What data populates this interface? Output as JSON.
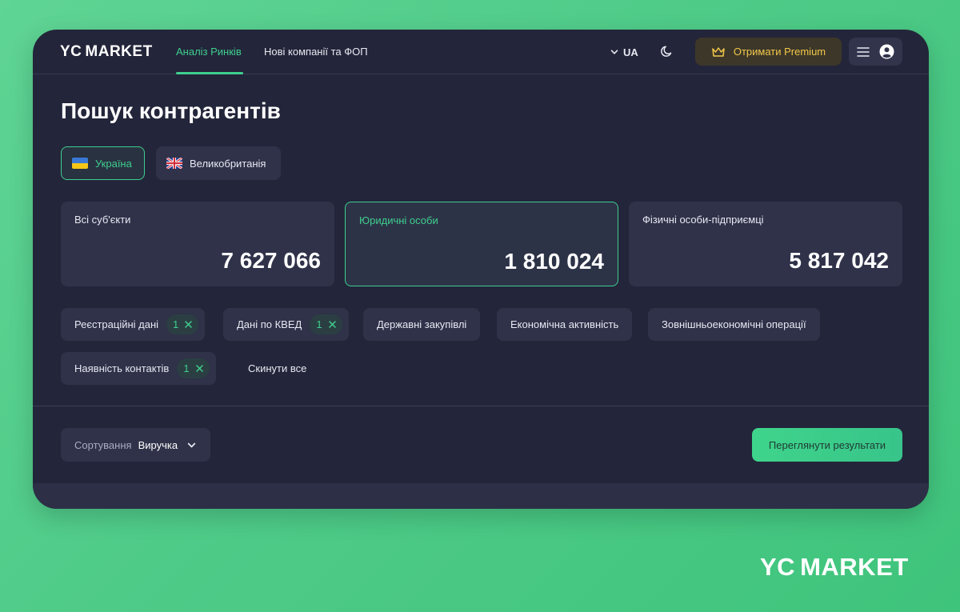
{
  "header": {
    "brand_prefix": "YC",
    "brand_suffix": "MARKET",
    "nav": [
      {
        "label": "Аналіз Ринків",
        "active": true
      },
      {
        "label": "Нові компанії та ФОП",
        "active": false
      }
    ],
    "language": "UA",
    "premium_label": "Отримати Premium",
    "icons": {
      "language": "chevron-down-icon",
      "theme": "moon-icon",
      "premium": "crown-icon",
      "menu": "hamburger-icon",
      "profile": "user-icon"
    }
  },
  "page": {
    "title": "Пошук контрагентів"
  },
  "countries": [
    {
      "label": "Україна",
      "flag": "ukraine-flag-icon",
      "active": true
    },
    {
      "label": "Великобританія",
      "flag": "uk-flag-icon",
      "active": false
    }
  ],
  "stats": [
    {
      "label": "Всі суб'єкти",
      "value": "7 627 066",
      "active": false
    },
    {
      "label": "Юридичні особи",
      "value": "1 810 024",
      "active": true
    },
    {
      "label": "Фізичні особи-підприємці",
      "value": "5 817 042",
      "active": false
    }
  ],
  "filters": [
    {
      "label": "Реєстраційні дані",
      "count": "1"
    },
    {
      "label": "Дані по КВЕД",
      "count": "1"
    },
    {
      "label": "Державні закупівлі",
      "count": ""
    },
    {
      "label": "Економічна активність",
      "count": ""
    },
    {
      "label": "Зовнішньоекономічні операції",
      "count": ""
    },
    {
      "label": "Наявність контактів",
      "count": "1"
    }
  ],
  "reset_label": "Скинути все",
  "sort": {
    "label": "Сортування",
    "value": "Виручка"
  },
  "results_label": "Переглянути результати",
  "footer_logo": {
    "prefix": "YC",
    "suffix": "MARKET"
  },
  "colors": {
    "accent": "#3ecf8e",
    "premium": "#f4c84a",
    "panel": "#23253a",
    "card": "#2f3249"
  }
}
